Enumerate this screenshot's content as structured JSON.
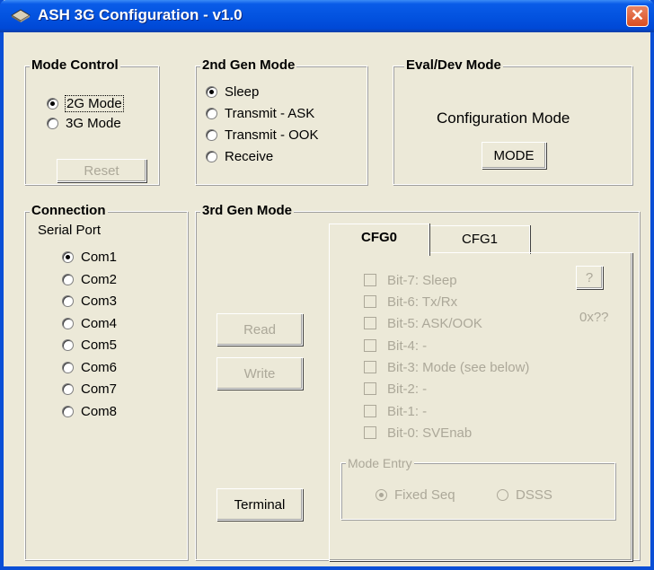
{
  "window": {
    "title": "ASH 3G Configuration - v1.0",
    "close_glyph": "✕"
  },
  "mode_control": {
    "title": "Mode Control",
    "options": [
      "2G Mode",
      "3G Mode"
    ],
    "selected": "2G Mode",
    "reset_label": "Reset"
  },
  "gen2": {
    "title": "2nd Gen Mode",
    "options": [
      "Sleep",
      "Transmit - ASK",
      "Transmit - OOK",
      "Receive"
    ],
    "selected": "Sleep"
  },
  "eval": {
    "title": "Eval/Dev Mode",
    "status": "Configuration Mode",
    "mode_button": "MODE"
  },
  "connection": {
    "title": "Connection",
    "subtitle": "Serial Port",
    "ports": [
      "Com1",
      "Com2",
      "Com3",
      "Com4",
      "Com5",
      "Com6",
      "Com7",
      "Com8"
    ],
    "selected": "Com1"
  },
  "gen3": {
    "title": "3rd Gen Mode",
    "read_label": "Read",
    "write_label": "Write",
    "terminal_label": "Terminal",
    "tabs": [
      "CFG0",
      "CFG1"
    ],
    "active_tab": "CFG0",
    "help_label": "?",
    "hex_value": "0x??",
    "bits": [
      "Bit-7: Sleep",
      "Bit-6: Tx/Rx",
      "Bit-5: ASK/OOK",
      "Bit-4: -",
      "Bit-3: Mode (see below)",
      "Bit-2: -",
      "Bit-1: -",
      "Bit-0: SVEnab"
    ],
    "mode_entry": {
      "title": "Mode Entry",
      "options": [
        "Fixed Seq",
        "DSSS"
      ],
      "selected": "Fixed Seq"
    }
  },
  "colors": {
    "face": "#ece9d8",
    "titlebar": "#0353e0",
    "disabled_text": "#aca899",
    "close": "#d94d22"
  }
}
